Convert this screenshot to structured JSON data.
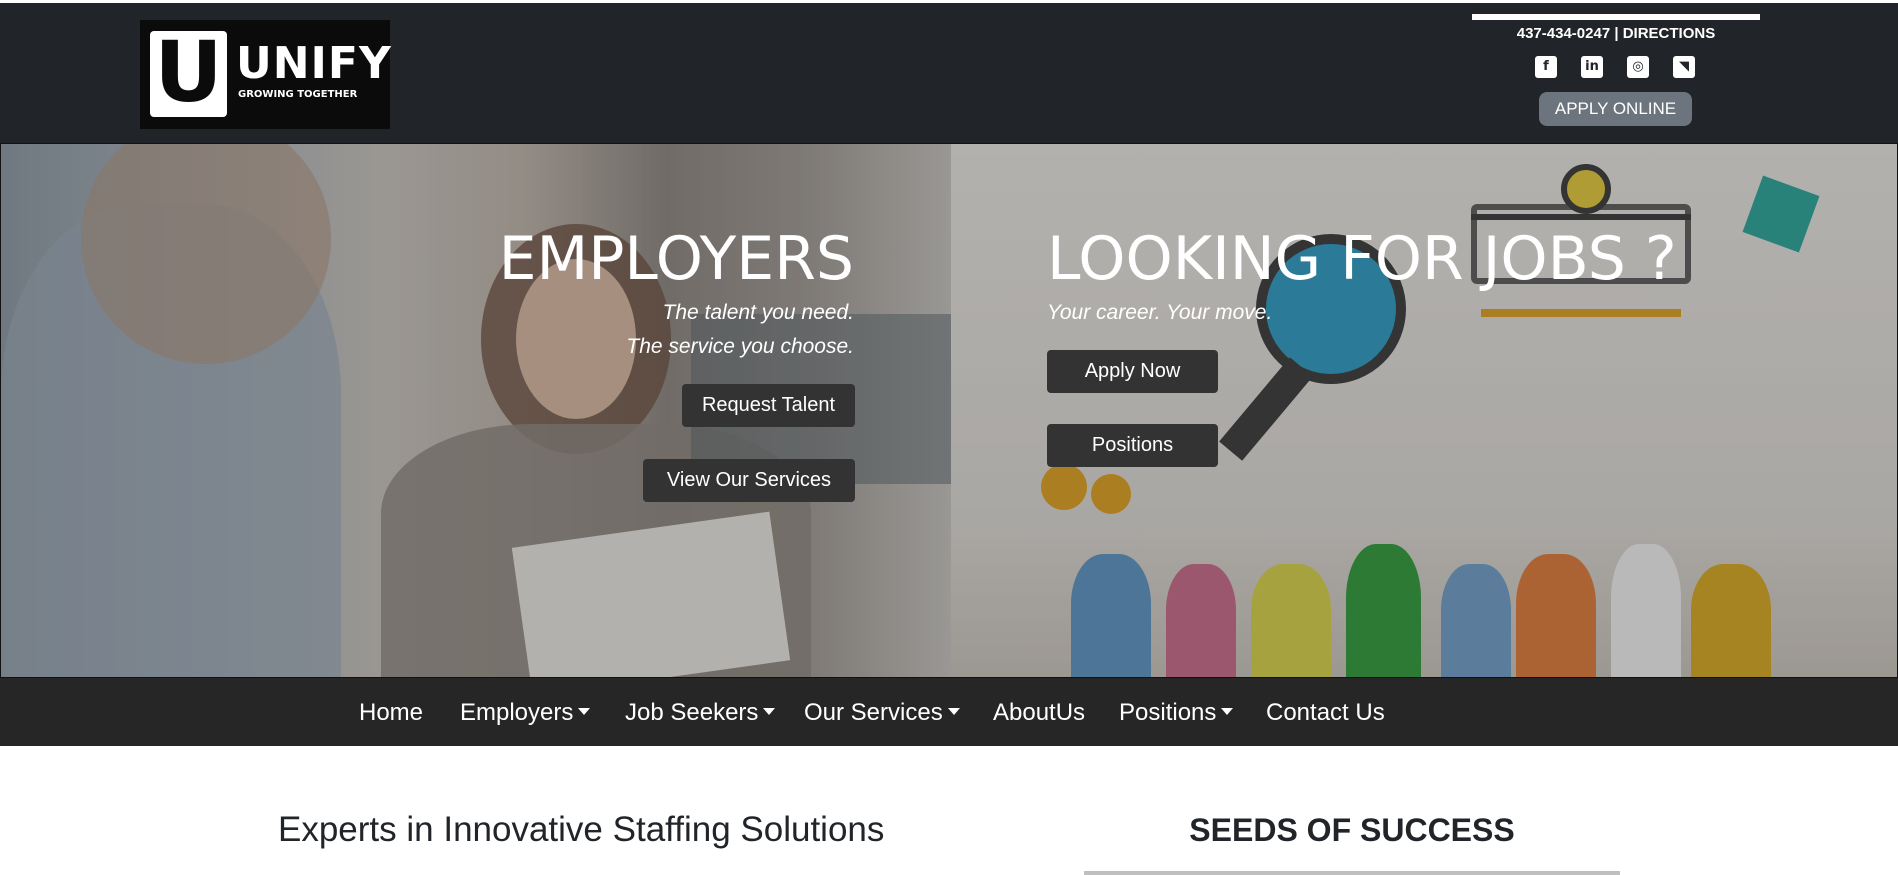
{
  "logo": {
    "letter": "U",
    "word": "UNIFY",
    "tagline": "GROWING TOGETHER"
  },
  "contact": {
    "phone": "437-434-0247",
    "separator": "|",
    "directions": "DIRECTIONS"
  },
  "social": [
    {
      "icon": "facebook-icon",
      "glyph": "f"
    },
    {
      "icon": "linkedin-icon",
      "glyph": "in"
    },
    {
      "icon": "instagram-icon",
      "glyph": "◎"
    },
    {
      "icon": "rss-icon",
      "glyph": "◥"
    }
  ],
  "apply_online": "APPLY ONLINE",
  "employers": {
    "title": "EMPLOYERS",
    "tagline_1": "The talent you need.",
    "tagline_2": "The service you choose.",
    "request_talent": "Request Talent",
    "view_services": "View Our Services"
  },
  "jobs": {
    "title": "LOOKING FOR JOBS ?",
    "tagline": "Your career. Your move.",
    "apply_now": "Apply Now",
    "positions": "Positions"
  },
  "nav": {
    "home": "Home",
    "employers": "Employers",
    "job_seekers": "Job Seekers",
    "our_services": "Our Services",
    "about_us": "AboutUs",
    "positions": "Positions",
    "contact_us": "Contact Us"
  },
  "content": {
    "experts_heading": "Experts in Innovative Staffing Solutions",
    "seeds_heading": "SEEDS OF SUCCESS"
  },
  "colors": {
    "header_bg": "#212529",
    "nav_bg": "#262626",
    "button_dark": "#333333",
    "apply_online_bg": "#6c757d"
  }
}
